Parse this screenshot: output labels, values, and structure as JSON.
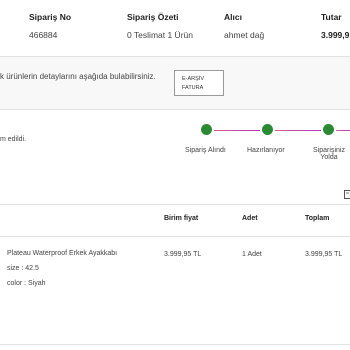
{
  "summary": {
    "headers": {
      "order_no": "Sipariş No",
      "order_summary": "Sipariş Özeti",
      "recipient": "Alıcı",
      "total": "Tutar"
    },
    "values": {
      "order_no": "466884",
      "order_summary": "0 Teslimat 1 Ürün",
      "recipient": "ahmet dağ",
      "total": "3.999,9"
    }
  },
  "info_band": {
    "text": "k ürünlerin detaylarını aşağıda bulabilirsiniz.",
    "efatura_line1": "E-ARŞİV",
    "efatura_line2": "FATURA"
  },
  "tracking": {
    "status_text": "m edildi.",
    "steps": [
      {
        "label": "Sipariş Alındı"
      },
      {
        "label": "Hazırlanıyor"
      },
      {
        "label_line1": "Siparişiniz",
        "label_line2": "Yolda"
      }
    ],
    "colors": {
      "step_dot": "#2a8a34",
      "line_start": "#e05a8a",
      "line_end": "#b13cc2"
    }
  },
  "product_table": {
    "headers": {
      "unit_price": "Birim fiyat",
      "quantity": "Adet",
      "total": "Toplam"
    },
    "row": {
      "name": "Plateau Waterproof Erkek Ayakkabı",
      "size": "size : 42.5",
      "color": "color : Siyah",
      "unit_price": "3.999,95 TL",
      "quantity": "1 Adet",
      "total": "3.999,95 TL"
    }
  },
  "icons": {
    "edit": "edit-icon"
  }
}
